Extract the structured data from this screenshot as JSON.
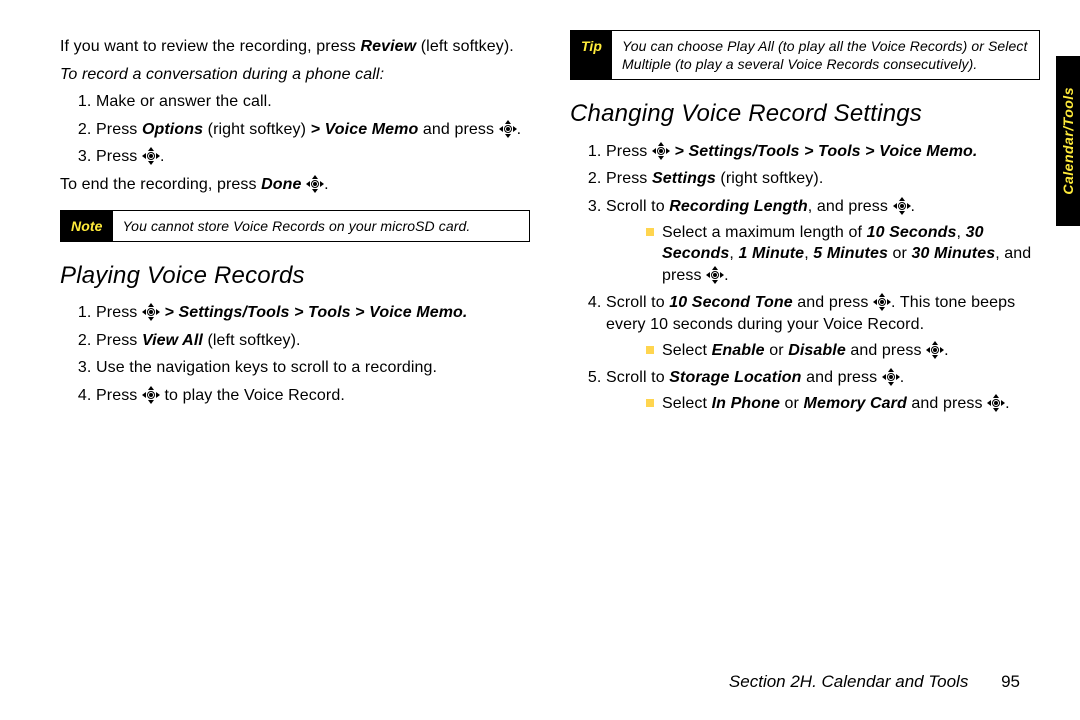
{
  "sidetab": "Calendar/Tools",
  "footer": {
    "section": "Section 2H. Calendar and Tools",
    "page": "95"
  },
  "left": {
    "intro_a": "If you want to review the recording, press ",
    "intro_b": "Review",
    "intro_c": " (left softkey).",
    "subhead": "To record a conversation during a phone call:",
    "s1": "Make or answer the call.",
    "s2a": "Press ",
    "s2b": "Options",
    "s2c": " (right softkey) ",
    "s2d": "> Voice Memo",
    "s2e": " and press ",
    "s3": "Press ",
    "end_a": "To end the recording, press ",
    "end_b": "Done ",
    "note_tag": "Note",
    "note_body": "You cannot store Voice Records on your microSD card.",
    "h2": "Playing Voice Records",
    "p1a": "Press ",
    "p1b": " > Settings/Tools > Tools > Voice Memo.",
    "p2a": "Press ",
    "p2b": "View All",
    "p2c": " (left softkey).",
    "p3": "Use the navigation keys to scroll to a recording.",
    "p4a": "Press ",
    "p4b": " to play the Voice Record."
  },
  "right": {
    "tip_tag": "Tip",
    "tip_body": "You can choose Play All (to play all the Voice Records) or Select Multiple (to play a several Voice Records consecutively).",
    "h2": "Changing Voice Record Settings",
    "c1a": "Press ",
    "c1b": " > Settings/Tools > Tools > Voice Memo.",
    "c2a": "Press ",
    "c2b": "Settings",
    "c2c": " (right softkey).",
    "c3a": "Scroll to ",
    "c3b": "Recording Length",
    "c3c": ", and press ",
    "c3sub_a": "Select a maximum length of ",
    "c3sub_b": "10 Seconds",
    "c3sub_c": ", ",
    "c3sub_d": "30 Seconds",
    "c3sub_e": ", ",
    "c3sub_f": "1 Minute",
    "c3sub_g": ", ",
    "c3sub_h": "5 Minutes",
    "c3sub_i": " or ",
    "c3sub_j": "30 Minutes",
    "c3sub_k": ", and press ",
    "c4a": "Scroll to ",
    "c4b": "10 Second Tone",
    "c4c": " and press ",
    "c4d": ". This tone beeps every 10 seconds during your Voice Record.",
    "c4sub_a": "Select ",
    "c4sub_b": "Enable",
    "c4sub_c": " or ",
    "c4sub_d": "Disable",
    "c4sub_e": " and press ",
    "c5a": "Scroll to ",
    "c5b": "Storage Location",
    "c5c": " and press ",
    "c5sub_a": "Select ",
    "c5sub_b": "In Phone",
    "c5sub_c": " or ",
    "c5sub_d": "Memory Card",
    "c5sub_e": " and press "
  }
}
